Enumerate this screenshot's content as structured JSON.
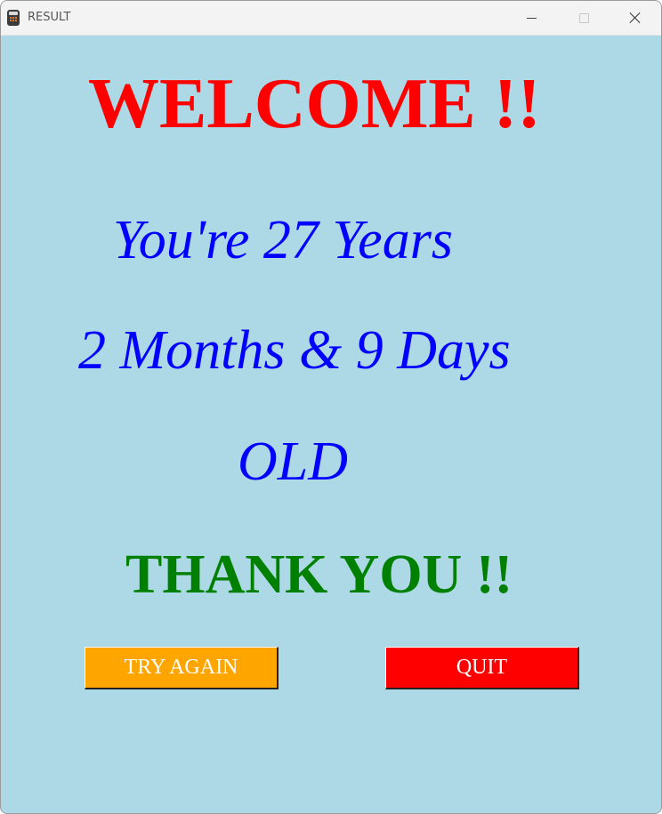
{
  "window": {
    "title": "RESULT",
    "icon": "calculator-icon",
    "controls": {
      "minimize": "minimize-icon",
      "maximize": "maximize-icon",
      "close": "close-icon"
    }
  },
  "content": {
    "background_color": "#add8e6",
    "welcome": "WELCOME !!",
    "years_line": "You're 27 Years",
    "months_line": "2 Months & 9 Days",
    "old_line": "OLD",
    "thanks": "THANK YOU !!",
    "colors": {
      "welcome": "#ff0000",
      "age_text": "#0000ff",
      "thanks": "#008000"
    }
  },
  "buttons": {
    "try_again": {
      "label": "TRY AGAIN",
      "color": "#ffa500"
    },
    "quit": {
      "label": "QUIT",
      "color": "#ff0000"
    }
  }
}
